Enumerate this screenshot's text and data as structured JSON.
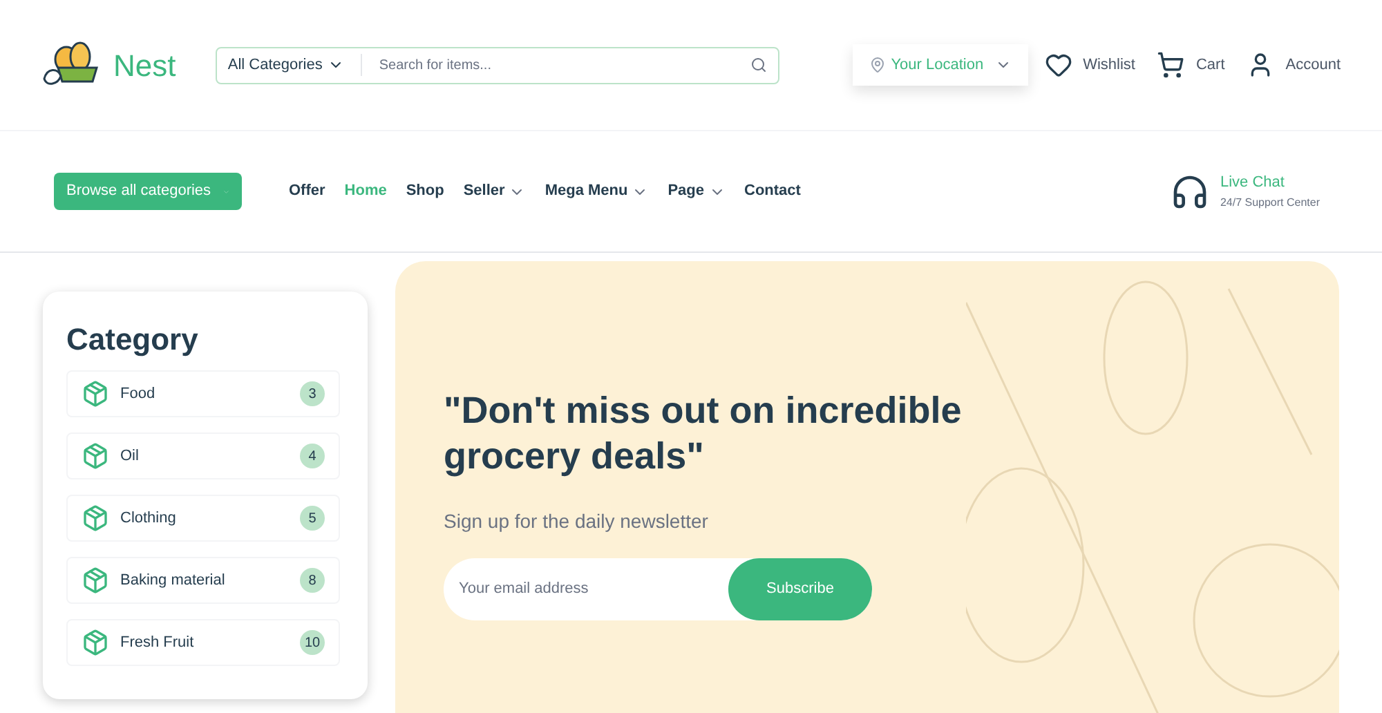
{
  "header": {
    "logo": "Nest",
    "search": {
      "category": "All Categories",
      "placeholder": "Search for items..."
    },
    "location": "Your Location",
    "actions": [
      {
        "kind": "wishlist",
        "label": "Wishlist"
      },
      {
        "kind": "cart",
        "label": "Cart"
      },
      {
        "kind": "account",
        "label": "Account"
      }
    ]
  },
  "nav": {
    "browse_button": "Browse all categories",
    "items": [
      {
        "label": "Offer",
        "selected": false,
        "dropdown": false
      },
      {
        "label": "Home",
        "selected": true,
        "dropdown": false
      },
      {
        "label": "Shop",
        "selected": false,
        "dropdown": false
      },
      {
        "label": "Seller",
        "selected": false,
        "dropdown": true
      },
      {
        "label": "Mega Menu",
        "selected": false,
        "dropdown": true
      },
      {
        "label": "Page",
        "selected": false,
        "dropdown": true
      },
      {
        "label": "Contact",
        "selected": false,
        "dropdown": false
      }
    ],
    "support": {
      "title": "Live Chat",
      "subtitle": "24/7 Support Center"
    }
  },
  "sidebar": {
    "title": "Category",
    "items": [
      {
        "label": "Food",
        "count": "3"
      },
      {
        "label": "Oil",
        "count": "4"
      },
      {
        "label": "Clothing",
        "count": "5"
      },
      {
        "label": "Baking material",
        "count": "8"
      },
      {
        "label": "Fresh Fruit",
        "count": "10"
      }
    ]
  },
  "hero": {
    "headline": "\"Don't miss out on incredible grocery deals\"",
    "subtitle": "Sign up for the daily newsletter",
    "email_placeholder": "Your email address",
    "button": "Subscribe"
  }
}
